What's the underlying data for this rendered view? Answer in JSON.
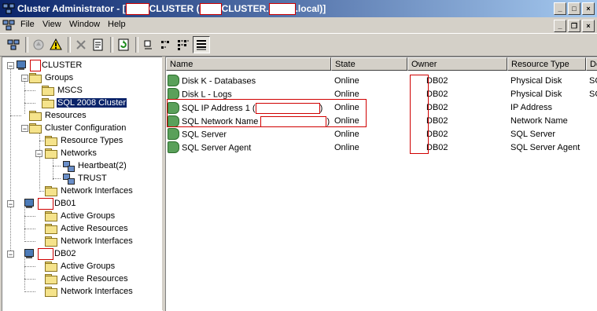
{
  "window": {
    "title_prefix": "Cluster Administrator - [",
    "title_part1": "CLUSTER (",
    "title_part2": "CLUSTER.",
    "title_part3": ".local)]",
    "minimize": "_",
    "maximize": "□",
    "close": "×"
  },
  "menu": {
    "file": "File",
    "view": "View",
    "window": "Window",
    "help": "Help"
  },
  "mdi": {
    "minimize": "_",
    "restore": "❐",
    "close": "×"
  },
  "tree": {
    "root": "CLUSTER",
    "groups": "Groups",
    "mscs": "MSCS",
    "sql_cluster": "SQL 2008 Cluster",
    "resources": "Resources",
    "cluster_config": "Cluster Configuration",
    "resource_types": "Resource Types",
    "networks": "Networks",
    "heartbeat": "Heartbeat(2)",
    "trust": "TRUST",
    "network_interfaces": "Network Interfaces",
    "db01": "DB01",
    "db01_active_groups": "Active Groups",
    "db01_active_resources": "Active Resources",
    "db01_network_interfaces": "Network Interfaces",
    "db02": "DB02",
    "db02_active_groups": "Active Groups",
    "db02_active_resources": "Active Resources",
    "db02_network_interfaces": "Network Interfaces"
  },
  "table": {
    "headers": {
      "name": "Name",
      "state": "State",
      "owner": "Owner",
      "type": "Resource Type",
      "desc": "De"
    },
    "rows": [
      {
        "name": "Disk K - Databases",
        "state": "Online",
        "owner": "DB02",
        "type": "Physical Disk",
        "desc": "SC"
      },
      {
        "name": "Disk L - Logs",
        "state": "Online",
        "owner": "DB02",
        "type": "Physical Disk",
        "desc": "SC"
      },
      {
        "name": "SQL IP Address 1 (",
        "name_suffix": ")",
        "state": "Online",
        "owner": "DB02",
        "type": "IP Address",
        "desc": ""
      },
      {
        "name": "SQL Network Name",
        "name_suffix": ")",
        "state": "Online",
        "owner": "DB02",
        "type": "Network Name",
        "desc": ""
      },
      {
        "name": "SQL Server",
        "state": "Online",
        "owner": "DB02",
        "type": "SQL Server",
        "desc": ""
      },
      {
        "name": "SQL Server Agent",
        "state": "Online",
        "owner": "DB02",
        "type": "SQL Server Agent",
        "desc": ""
      }
    ]
  },
  "colors": {
    "titlebar": "#0a246a",
    "selection": "#0a246a",
    "redaction_border": "#d00000",
    "resource_icon": "#5aa05a"
  }
}
